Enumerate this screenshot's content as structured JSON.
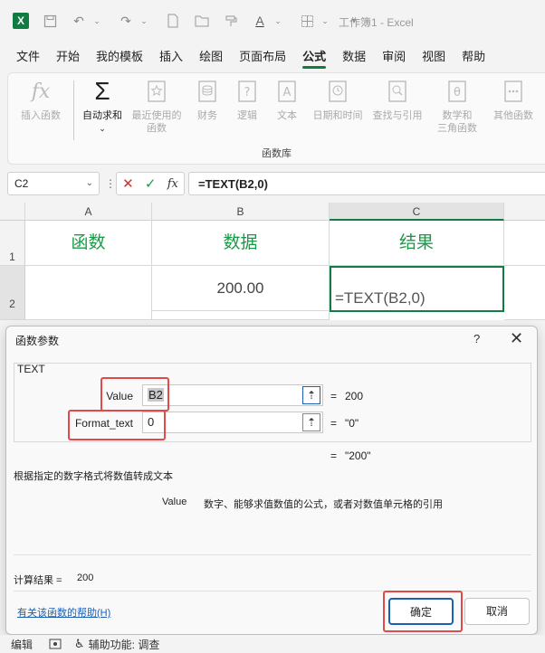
{
  "titlebar": {
    "app_icon": "X",
    "document_title": "工作簿1  -  Excel",
    "font_color_letter": "A"
  },
  "menu": [
    "文件",
    "开始",
    "我的模板",
    "插入",
    "绘图",
    "页面布局",
    "公式",
    "数据",
    "审阅",
    "视图",
    "帮助"
  ],
  "ribbon": {
    "insert_function": "插入函数",
    "autosum": "自动求和",
    "recent_1": "最近使用的",
    "recent_2": "函数",
    "finance": "财务",
    "logic": "逻辑",
    "text": "文本",
    "datetime": "日期和时间",
    "lookup": "查找与引用",
    "math_1": "数学和",
    "math_2": "三角函数",
    "more": "其他函数",
    "group_label": "函数库"
  },
  "formulabar": {
    "namebox": "C2",
    "formula": "=TEXT(B2,0)",
    "fx_glyph": "fx"
  },
  "sheet": {
    "columns": [
      "A",
      "B",
      "C"
    ],
    "rows": [
      "1",
      "2"
    ],
    "headers": [
      "函数",
      "数据",
      "结果"
    ],
    "b2": "200.00",
    "c2": "=TEXT(B2,0)"
  },
  "dialog": {
    "title": "函数参数",
    "help": "?",
    "function_name": "TEXT",
    "args": [
      {
        "label": "Value",
        "value": "B2",
        "result": "200"
      },
      {
        "label": "Format_text",
        "value": "0",
        "result": "\"0\""
      }
    ],
    "eq": "=",
    "total_result": "\"200\"",
    "description": "根据指定的数字格式将数值转成文本",
    "arg_desc_name": "Value",
    "arg_desc_text": "数字、能够求值数值的公式，或者对数值单元格的引用",
    "calc_label": "计算结果 =",
    "calc_value": "200",
    "help_link": "有关该函数的帮助(H)",
    "ok": "确定",
    "cancel": "取消"
  },
  "status": {
    "mode": "编辑",
    "accessibility": "辅助功能: 调查"
  }
}
